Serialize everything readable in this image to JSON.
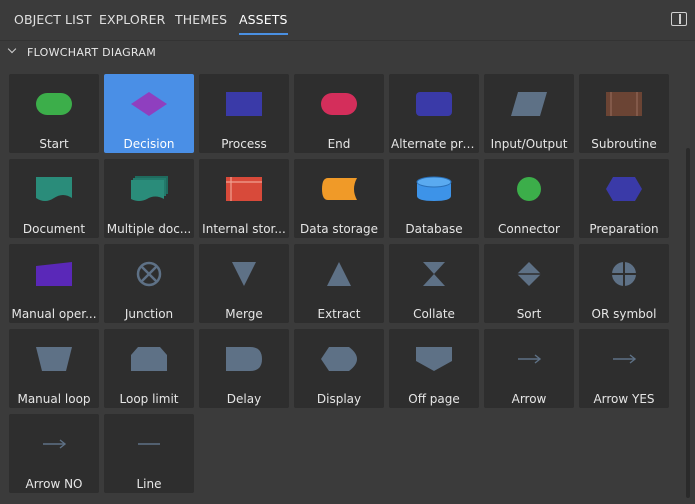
{
  "tabs": [
    {
      "label": "OBJECT LIST",
      "active": false
    },
    {
      "label": "EXPLORER",
      "active": false
    },
    {
      "label": "THEMES",
      "active": false
    },
    {
      "label": "ASSETS",
      "active": true
    }
  ],
  "section": {
    "title": "FLOWCHART DIAGRAM",
    "expanded": true
  },
  "colors": {
    "accent": "#4a8fe6",
    "tab_underline": "#4a90e2",
    "tile_bg": "#2e2e2e",
    "panel_bg": "#3b3b3b",
    "gray_shape": "#5e7186"
  },
  "assets": [
    {
      "label": "Start",
      "icon": "start-rounded-rect-icon",
      "color": "#3cae4a",
      "selected": false
    },
    {
      "label": "Decision",
      "icon": "decision-diamond-icon",
      "color": "#8f3fbf",
      "selected": true
    },
    {
      "label": "Process",
      "icon": "process-rect-icon",
      "color": "#3a3aa8",
      "selected": false
    },
    {
      "label": "End",
      "icon": "end-rounded-rect-icon",
      "color": "#d42e5b",
      "selected": false
    },
    {
      "label": "Alternate pro...",
      "icon": "alternate-process-icon",
      "color": "#3a3aa8",
      "selected": false
    },
    {
      "label": "Input/Output",
      "icon": "parallelogram-icon",
      "color": "#5e7186",
      "selected": false
    },
    {
      "label": "Subroutine",
      "icon": "subroutine-icon",
      "color": "#6b4434",
      "selected": false
    },
    {
      "label": "Document",
      "icon": "document-icon",
      "color": "#2a8c7a",
      "selected": false
    },
    {
      "label": "Multiple doc...",
      "icon": "multiple-documents-icon",
      "color": "#2a8c7a",
      "selected": false
    },
    {
      "label": "Internal stor...",
      "icon": "internal-storage-icon",
      "color": "#d84a3a",
      "selected": false
    },
    {
      "label": "Data storage",
      "icon": "data-storage-icon",
      "color": "#f09a28",
      "selected": false
    },
    {
      "label": "Database",
      "icon": "database-cylinder-icon",
      "color": "#3d93e8",
      "selected": false
    },
    {
      "label": "Connector",
      "icon": "connector-circle-icon",
      "color": "#3cae4a",
      "selected": false
    },
    {
      "label": "Preparation",
      "icon": "preparation-hexagon-icon",
      "color": "#3a3aa8",
      "selected": false
    },
    {
      "label": "Manual oper...",
      "icon": "manual-operation-icon",
      "color": "#5a28b8",
      "selected": false
    },
    {
      "label": "Junction",
      "icon": "junction-icon",
      "color": "#5e7186",
      "selected": false
    },
    {
      "label": "Merge",
      "icon": "merge-triangle-icon",
      "color": "#5e7186",
      "selected": false
    },
    {
      "label": "Extract",
      "icon": "extract-triangle-icon",
      "color": "#5e7186",
      "selected": false
    },
    {
      "label": "Collate",
      "icon": "collate-icon",
      "color": "#5e7186",
      "selected": false
    },
    {
      "label": "Sort",
      "icon": "sort-icon",
      "color": "#5e7186",
      "selected": false
    },
    {
      "label": "OR symbol",
      "icon": "or-symbol-icon",
      "color": "#5e7186",
      "selected": false
    },
    {
      "label": "Manual loop",
      "icon": "manual-loop-icon",
      "color": "#5e7186",
      "selected": false
    },
    {
      "label": "Loop limit",
      "icon": "loop-limit-icon",
      "color": "#5e7186",
      "selected": false
    },
    {
      "label": "Delay",
      "icon": "delay-icon",
      "color": "#5e7186",
      "selected": false
    },
    {
      "label": "Display",
      "icon": "display-icon",
      "color": "#5e7186",
      "selected": false
    },
    {
      "label": "Off page",
      "icon": "off-page-icon",
      "color": "#5e7186",
      "selected": false
    },
    {
      "label": "Arrow",
      "icon": "arrow-icon",
      "color": "#5e7186",
      "selected": false
    },
    {
      "label": "Arrow YES",
      "icon": "arrow-yes-icon",
      "color": "#5e7186",
      "selected": false
    },
    {
      "label": "Arrow NO",
      "icon": "arrow-no-icon",
      "color": "#5e7186",
      "selected": false
    },
    {
      "label": "Line",
      "icon": "line-icon",
      "color": "#5e7186",
      "selected": false
    }
  ]
}
